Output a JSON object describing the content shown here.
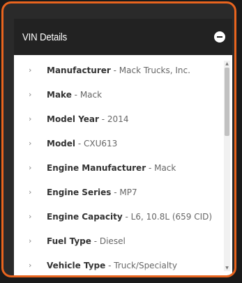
{
  "panel": {
    "title": "VIN Details",
    "collapse_icon": "minus-circle-icon",
    "accent_color": "#e8641e",
    "header_bg": "#222222"
  },
  "details": [
    {
      "key": "Manufacturer",
      "value": "Mack Trucks, Inc."
    },
    {
      "key": "Make",
      "value": "Mack"
    },
    {
      "key": "Model Year",
      "value": "2014"
    },
    {
      "key": "Model",
      "value": "CXU613"
    },
    {
      "key": "Engine Manufacturer",
      "value": "Mack"
    },
    {
      "key": "Engine Series",
      "value": "MP7"
    },
    {
      "key": "Engine Capacity",
      "value": "L6, 10.8L (659 CID)"
    },
    {
      "key": "Fuel Type",
      "value": "Diesel"
    },
    {
      "key": "Vehicle Type",
      "value": "Truck/Specialty"
    }
  ],
  "separator": " - ",
  "chevron": "›"
}
